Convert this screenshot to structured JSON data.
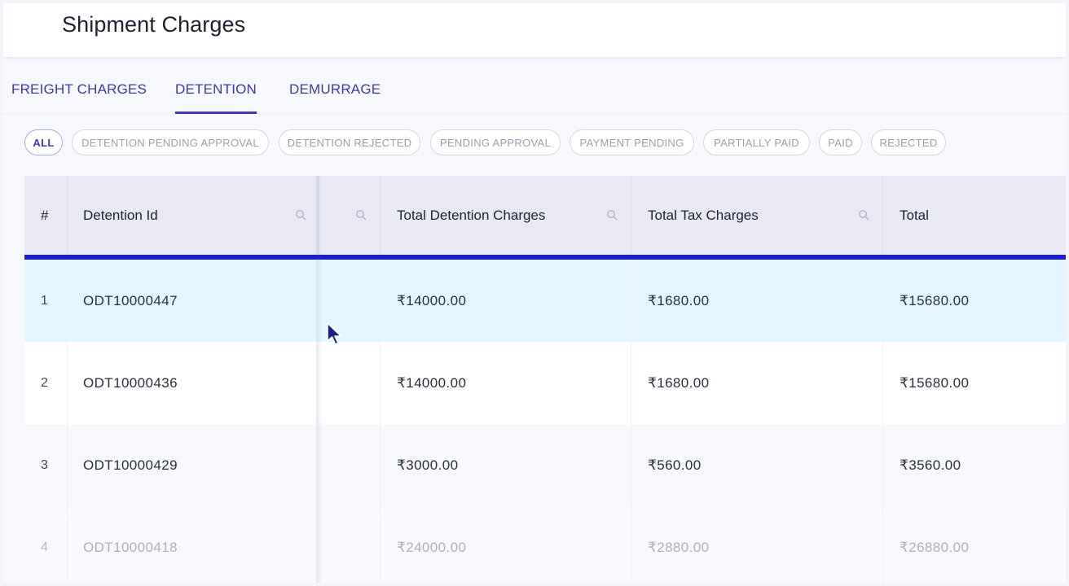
{
  "header": {
    "title": "Shipment Charges"
  },
  "tabs": [
    {
      "label": "FREIGHT CHARGES",
      "active": false
    },
    {
      "label": "DETENTION",
      "active": true
    },
    {
      "label": "DEMURRAGE",
      "active": false
    }
  ],
  "filters": [
    {
      "label": "ALL",
      "active": true
    },
    {
      "label": "DETENTION PENDING APPROVAL",
      "active": false
    },
    {
      "label": "DETENTION REJECTED",
      "active": false
    },
    {
      "label": "PENDING APPROVAL",
      "active": false
    },
    {
      "label": "PAYMENT PENDING",
      "active": false
    },
    {
      "label": "PARTIALLY PAID",
      "active": false
    },
    {
      "label": "PAID",
      "active": false
    },
    {
      "label": "REJECTED",
      "active": false
    }
  ],
  "table": {
    "columns": [
      "#",
      "Detention Id",
      "",
      "Total Detention Charges",
      "Total Tax Charges",
      "Total"
    ],
    "rows": [
      {
        "index": "1",
        "detention_id": "ODT10000447",
        "detention_charges": "₹14000.00",
        "tax_charges": "₹1680.00",
        "total": "₹15680.00"
      },
      {
        "index": "2",
        "detention_id": "ODT10000436",
        "detention_charges": "₹14000.00",
        "tax_charges": "₹1680.00",
        "total": "₹15680.00"
      },
      {
        "index": "3",
        "detention_id": "ODT10000429",
        "detention_charges": "₹3000.00",
        "tax_charges": "₹560.00",
        "total": "₹3560.00"
      },
      {
        "index": "4",
        "detention_id": "ODT10000418",
        "detention_charges": "₹24000.00",
        "tax_charges": "₹2880.00",
        "total": "₹26880.00"
      }
    ]
  },
  "colors": {
    "accent": "#3a3ab4",
    "header_underline": "#1c1ccf",
    "highlight_row": "#e3f6fd"
  },
  "icons": {
    "column_search": "search-icon",
    "pointer": "cursor-arrow-icon"
  }
}
